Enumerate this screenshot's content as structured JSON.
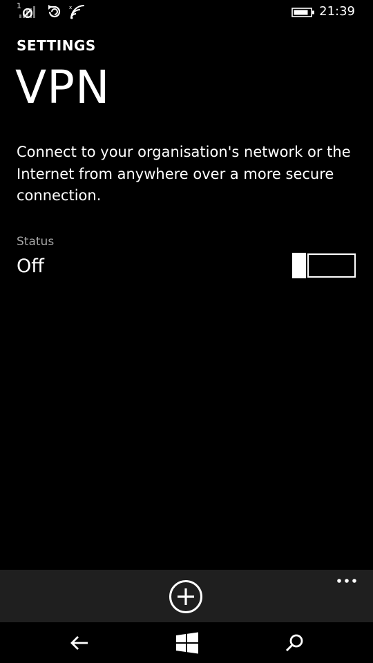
{
  "status_bar": {
    "sim_number": "1",
    "time": "21:39",
    "icons": [
      "sim-no-signal-icon",
      "data-sync-icon",
      "wifi-icon",
      "battery-icon"
    ]
  },
  "header": {
    "pivot_title": "SETTINGS",
    "page_title": "VPN"
  },
  "main": {
    "description": "Connect to your organisation's network or the Internet from anywhere over a more secure connection.",
    "status_label": "Status",
    "status_value": "Off",
    "toggle_on": false
  },
  "app_bar": {
    "buttons": [
      "add-icon",
      "more-icon"
    ]
  },
  "nav_bar": {
    "buttons": [
      "back-arrow-icon",
      "windows-start-icon",
      "search-icon"
    ]
  },
  "colors": {
    "background": "#000000",
    "foreground": "#ffffff",
    "subtle_text": "#a6a6a6",
    "app_bar": "#1f1f1f"
  }
}
